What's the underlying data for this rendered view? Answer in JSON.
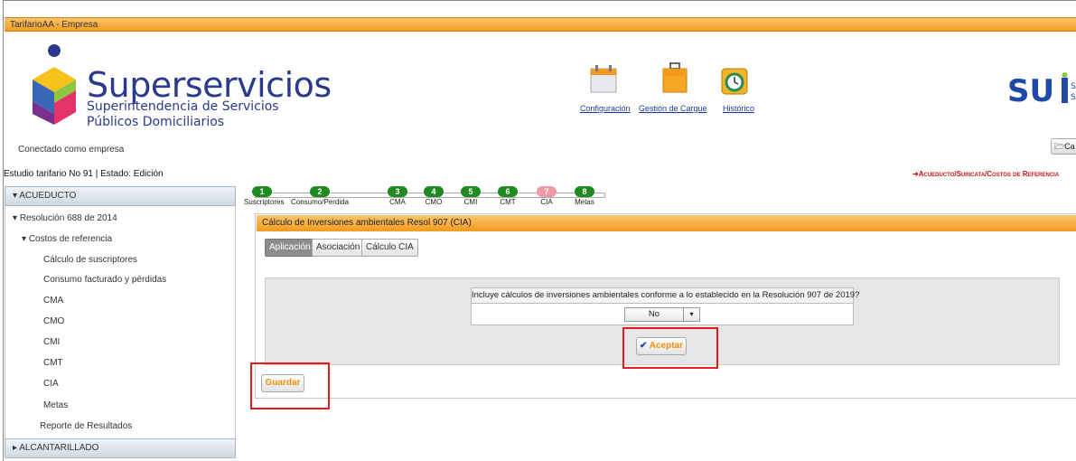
{
  "window": {
    "title": "TarifarioAA - Empresa"
  },
  "branding": {
    "name": "Superservicios",
    "sub1": "Superintendencia de Servicios",
    "sub2": "Públicos Domiciliarios",
    "sui_text": "SUi",
    "sui_side": "S\nS"
  },
  "toolbar": {
    "configuracion": "Configuración",
    "gestion": "Gestión de Cargue",
    "historico": "Histórico",
    "ca_button": "Ca"
  },
  "session": {
    "connected": "Conectado como empresa"
  },
  "study": {
    "status": "Estudio tarifario No 91 | Estado: Edición",
    "breadcrumb": "Acueducto/Suricata/Costos de Referencia"
  },
  "sidebar": {
    "header": "ACUEDUCTO",
    "items": [
      "Resolución 688 de 2014",
      "Costos de referencia",
      "Cálculo de suscriptores",
      "Consumo facturado y pérdidas",
      "CMA",
      "CMO",
      "CMI",
      "CMT",
      "CIA",
      "Metas",
      "Reporte de Resultados"
    ],
    "footer": "ALCANTARILLADO"
  },
  "steps": [
    {
      "num": "1",
      "label": "Suscriptores"
    },
    {
      "num": "2",
      "label": "Consumo/Perdida"
    },
    {
      "num": "3",
      "label": "CMA"
    },
    {
      "num": "4",
      "label": "CMO"
    },
    {
      "num": "5",
      "label": "CMI"
    },
    {
      "num": "6",
      "label": "CMT"
    },
    {
      "num": "7",
      "label": "CIA"
    },
    {
      "num": "8",
      "label": "Metas"
    }
  ],
  "panel": {
    "title": "Cálculo de Inversiones ambientales Resol 907 (CIA)",
    "tabs": [
      "Aplicación",
      "Asociación",
      "Cálculo CIA"
    ],
    "question": "Incluye cálculos de inversiones ambientales conforme a lo establecido en la Resolución 907 de 2019?",
    "select_value": "No",
    "accept": "Aceptar",
    "save": "Guardar"
  },
  "colors": {
    "accent": "#f29a1f",
    "step_done": "#1f8a1f",
    "step_current": "#f19aa6",
    "highlight": "#e41b1b"
  }
}
